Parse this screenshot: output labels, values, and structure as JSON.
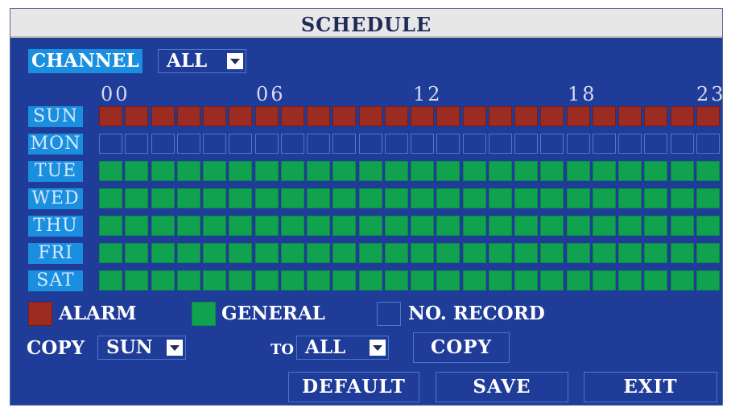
{
  "window": {
    "title": "SCHEDULE"
  },
  "channel": {
    "label": "CHANNEL",
    "value": "ALL"
  },
  "hours": {
    "h00": "00",
    "h06": "06",
    "h12": "12",
    "h18": "18",
    "h23": "23"
  },
  "days": [
    {
      "label": "SUN",
      "mode": "alarm"
    },
    {
      "label": "MON",
      "mode": "norecord"
    },
    {
      "label": "TUE",
      "mode": "general"
    },
    {
      "label": "WED",
      "mode": "general"
    },
    {
      "label": "THU",
      "mode": "general"
    },
    {
      "label": "FRI",
      "mode": "general"
    },
    {
      "label": "SAT",
      "mode": "general"
    }
  ],
  "legend": {
    "alarm": "ALARM",
    "general": "GENERAL",
    "norecord": "NO. RECORD"
  },
  "colors": {
    "alarm": "#9c2b22",
    "general": "#10a24f",
    "norecord": "#1f3c99",
    "background": "#1f3c99",
    "accent": "#1a8fe0"
  },
  "copy": {
    "label": "COPY",
    "from": "SUN",
    "to_label": "TO",
    "to": "ALL",
    "button": "COPY"
  },
  "buttons": {
    "default": "DEFAULT",
    "save": "SAVE",
    "exit": "EXIT"
  }
}
